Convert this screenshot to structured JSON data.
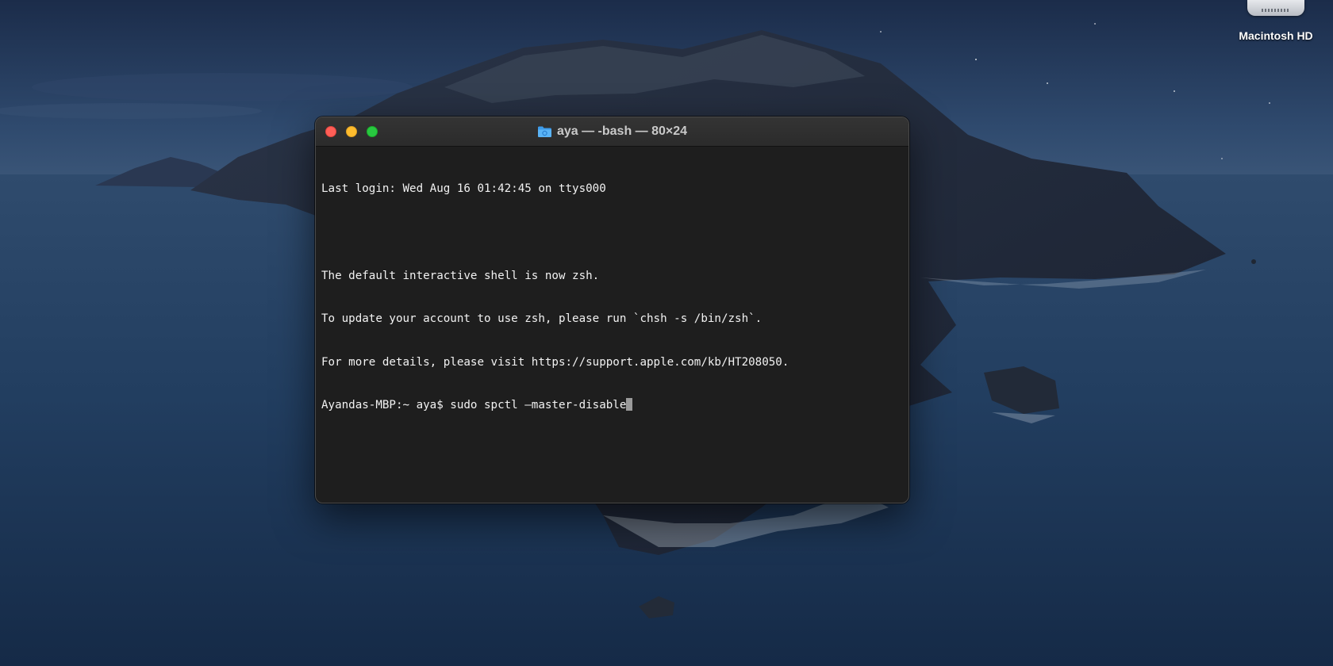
{
  "desktop": {
    "icons": [
      {
        "label": "Macintosh HD",
        "icon": "hard-drive-icon"
      }
    ]
  },
  "terminal": {
    "title": "aya — -bash — 80×24",
    "title_icon": "folder-icon",
    "lines": [
      "Last login: Wed Aug 16 01:42:45 on ttys000",
      "",
      "The default interactive shell is now zsh.",
      "To update your account to use zsh, please run `chsh -s /bin/zsh`.",
      "For more details, please visit https://support.apple.com/kb/HT208050."
    ],
    "prompt": "Ayandas-MBP:~ aya$ ",
    "command": "sudo spctl —master-disable"
  },
  "colors": {
    "close": "#ff5f57",
    "minimize": "#febc2e",
    "zoom": "#28c840",
    "terminal_bg": "#1e1e1e",
    "terminal_fg": "#f2f2f2"
  }
}
